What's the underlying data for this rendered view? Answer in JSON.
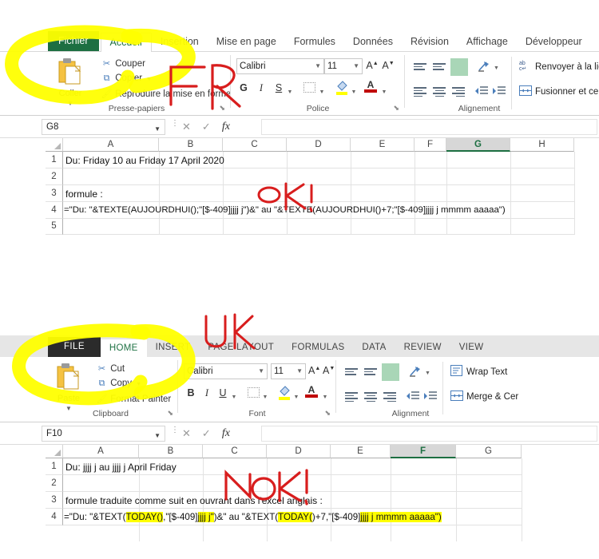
{
  "annotations": {
    "fr_label": "FR",
    "uk_label": "UK",
    "fr_status": "OK!",
    "uk_status": "NOK!"
  },
  "fr": {
    "tabs": [
      {
        "label": "Fichier",
        "type": "file"
      },
      {
        "label": "Accueil",
        "type": "active"
      },
      {
        "label": "Insertion",
        "type": "normal"
      },
      {
        "label": "Mise en page",
        "type": "normal"
      },
      {
        "label": "Formules",
        "type": "normal"
      },
      {
        "label": "Données",
        "type": "normal"
      },
      {
        "label": "Révision",
        "type": "normal"
      },
      {
        "label": "Affichage",
        "type": "normal"
      },
      {
        "label": "Développeur",
        "type": "normal"
      }
    ],
    "ribbon": {
      "clipboard": {
        "group_label": "Presse-papiers",
        "paste_label": "Coller",
        "cut_label": "Couper",
        "copy_label": "Copier",
        "format_painter_label": "Reproduire la mise en forme"
      },
      "font": {
        "group_label": "Police",
        "font_name": "Calibri",
        "font_size": "11",
        "bold_label": "G",
        "italic_label": "I",
        "underline_label": "S"
      },
      "alignment": {
        "group_label": "Alignement",
        "wrap_label": "Renvoyer à la ligne",
        "merge_label": "Fusionner et cent"
      }
    },
    "formula_bar": {
      "name_box": "G8",
      "formula_value": "",
      "cancel_icon": "✕",
      "accept_icon": "✓",
      "fx_icon": "fx"
    },
    "sheet": {
      "columns": [
        "A",
        "B",
        "C",
        "D",
        "E",
        "F",
        "G",
        "H"
      ],
      "selected_column": "G",
      "rows": [
        "1",
        "2",
        "3",
        "4",
        "5"
      ],
      "cells": [
        {
          "row": 1,
          "text": "Du: Friday 10 au Friday 17 April 2020"
        },
        {
          "row": 3,
          "text": "formule :"
        },
        {
          "row": 4,
          "text": "=\"Du: \"&TEXTE(AUJOURDHUI();\"[$-409]jjjj j\")&\" au \"&TEXTE(AUJOURDHUI()+7;\"[$-409]jjjj j mmmm aaaaa\")"
        }
      ]
    }
  },
  "uk": {
    "tabs": [
      {
        "label": "FILE",
        "type": "file"
      },
      {
        "label": "HOME",
        "type": "active"
      },
      {
        "label": "INSERT",
        "type": "normal"
      },
      {
        "label": "PAGE LAYOUT",
        "type": "normal"
      },
      {
        "label": "FORMULAS",
        "type": "normal"
      },
      {
        "label": "DATA",
        "type": "normal"
      },
      {
        "label": "REVIEW",
        "type": "normal"
      },
      {
        "label": "VIEW",
        "type": "normal"
      }
    ],
    "ribbon": {
      "clipboard": {
        "group_label": "Clipboard",
        "paste_label": "Paste",
        "cut_label": "Cut",
        "copy_label": "Copy",
        "format_painter_label": "Format Painter"
      },
      "font": {
        "group_label": "Font",
        "font_name": "Calibri",
        "font_size": "11",
        "bold_label": "B",
        "italic_label": "I",
        "underline_label": "U"
      },
      "alignment": {
        "group_label": "Alignment",
        "wrap_label": "Wrap Text",
        "merge_label": "Merge & Cer"
      }
    },
    "formula_bar": {
      "name_box": "F10",
      "formula_value": "",
      "cancel_icon": "✕",
      "accept_icon": "✓",
      "fx_icon": "fx"
    },
    "sheet": {
      "columns": [
        "A",
        "B",
        "C",
        "D",
        "E",
        "F",
        "G"
      ],
      "selected_column": "F",
      "rows": [
        "1",
        "2",
        "3",
        "4"
      ],
      "cells": [
        {
          "row": 1,
          "text": "Du: jjjj j au jjjj j April Friday"
        },
        {
          "row": 3,
          "text": "formule traduite comme suit en ouvrant dans l'excel anglais :"
        }
      ],
      "formula_segments": [
        {
          "text": "=\"Du: \"&TEXT(",
          "hl": false
        },
        {
          "text": "TODAY()",
          "hl": true
        },
        {
          "text": ",\"[$-409]",
          "hl": false
        },
        {
          "text": "jjjj j\"",
          "hl": true
        },
        {
          "text": ")&\" au \"&TEXT(",
          "hl": false
        },
        {
          "text": "TODAY(",
          "hl": true
        },
        {
          "text": ")+7,\"[$-409]",
          "hl": false
        },
        {
          "text": "jjjj j mmmm aaaaa\")",
          "hl": true
        }
      ]
    }
  },
  "colors": {
    "excel_green": "#1d6f42",
    "highlight_yellow": "#ffff00",
    "annotation_red": "#e02020",
    "file_tab_dark": "#2b2b2b"
  }
}
